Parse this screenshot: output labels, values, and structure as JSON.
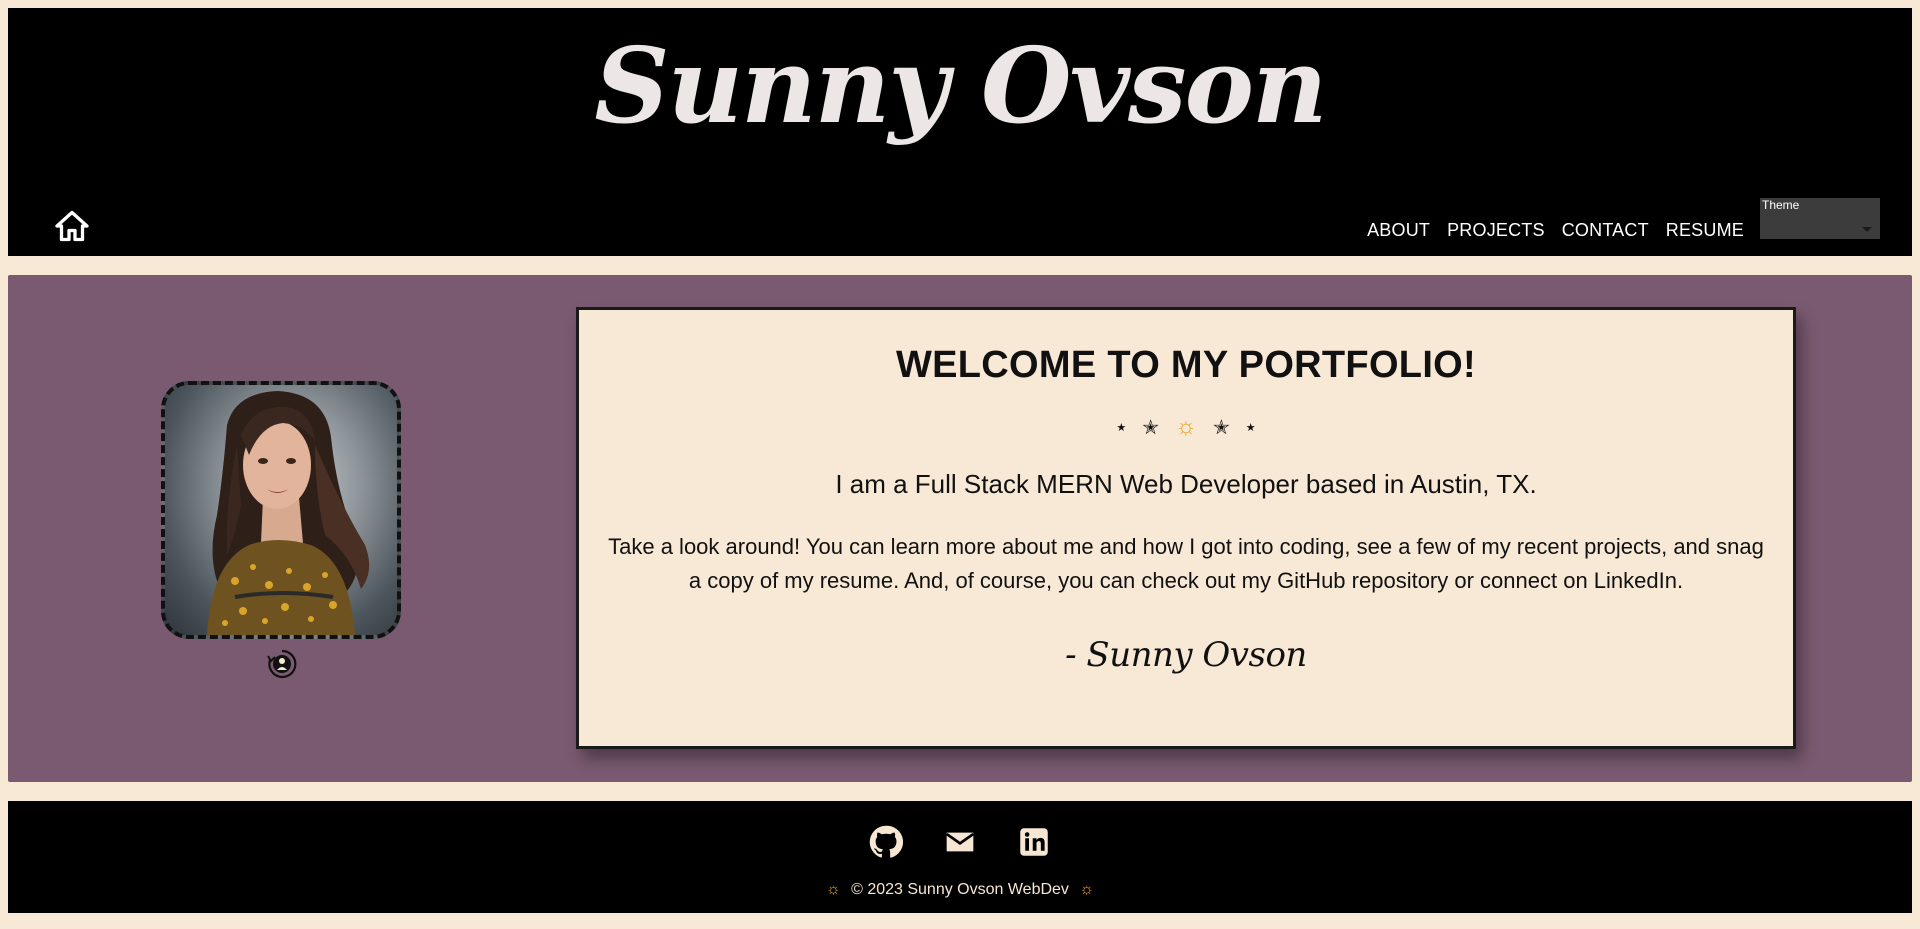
{
  "header": {
    "site_title": "Sunny Ovson",
    "nav": [
      {
        "label": "ABOUT"
      },
      {
        "label": "PROJECTS"
      },
      {
        "label": "CONTACT"
      },
      {
        "label": "RESUME"
      }
    ],
    "theme_select": {
      "label": "Theme",
      "value": ""
    }
  },
  "main": {
    "avatar_alt": "portrait-photo",
    "welcome": {
      "title": "WELCOME TO MY PORTFOLIO!",
      "divider": {
        "small_star": "★",
        "star": "✭",
        "sun": "☼"
      },
      "tagline": "I am a Full Stack MERN Web Developer based in Austin, TX.",
      "intro": "Take a look around! You can learn more about me and how I got into coding, see a few of my recent projects, and snag a copy of my resume. And, of course, you can check out my GitHub repository or connect on LinkedIn.",
      "signature": "- Sunny Ovson"
    }
  },
  "footer": {
    "social": [
      {
        "icon": "github-icon"
      },
      {
        "icon": "email-icon"
      },
      {
        "icon": "linkedin-icon"
      }
    ],
    "sun_left": "☼",
    "copyright": "© 2023 Sunny Ovson WebDev",
    "sun_right": "☼"
  },
  "colors": {
    "page_bg": "#f8e9d6",
    "header_bg": "#000000",
    "main_bg": "#7a5a70",
    "card_bg": "#f8e9d6",
    "accent_sun": "#f0a020"
  }
}
